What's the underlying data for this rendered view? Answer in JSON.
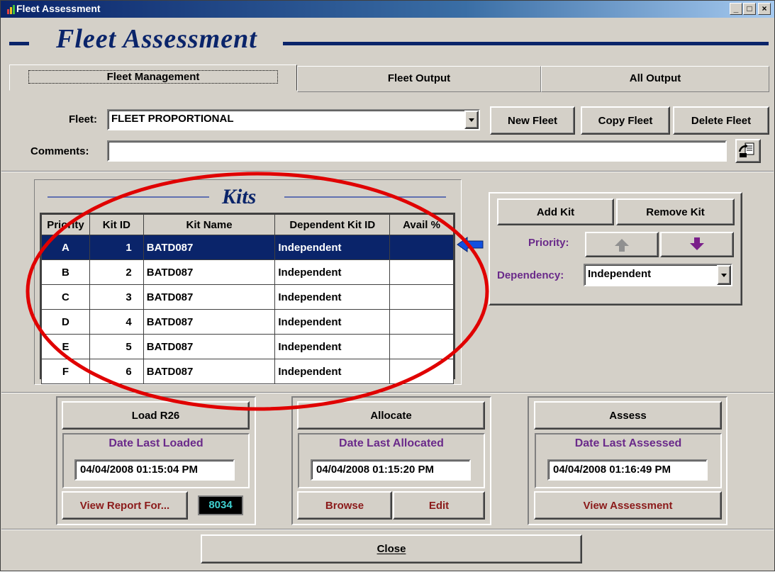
{
  "window": {
    "title": "Fleet Assessment",
    "controls": [
      "_",
      "□",
      "×"
    ]
  },
  "header": {
    "title": "Fleet Assessment"
  },
  "tabs": [
    {
      "label": "Fleet Management",
      "active": true
    },
    {
      "label": "Fleet Output",
      "active": false
    },
    {
      "label": "All Output",
      "active": false
    }
  ],
  "fleet": {
    "label": "Fleet:",
    "value": "FLEET PROPORTIONAL",
    "new_label": "New Fleet",
    "copy_label": "Copy Fleet",
    "delete_label": "Delete Fleet"
  },
  "comments": {
    "label": "Comments:",
    "value": ""
  },
  "kits": {
    "title": "Kits",
    "columns": [
      "Priority",
      "Kit ID",
      "Kit Name",
      "Dependent Kit ID",
      "Avail %"
    ],
    "rows": [
      {
        "priority": "A",
        "kit_id": "1",
        "kit_name": "BATD087",
        "dependent": "Independent",
        "avail": ""
      },
      {
        "priority": "B",
        "kit_id": "2",
        "kit_name": "BATD087",
        "dependent": "Independent",
        "avail": ""
      },
      {
        "priority": "C",
        "kit_id": "3",
        "kit_name": "BATD087",
        "dependent": "Independent",
        "avail": ""
      },
      {
        "priority": "D",
        "kit_id": "4",
        "kit_name": "BATD087",
        "dependent": "Independent",
        "avail": ""
      },
      {
        "priority": "E",
        "kit_id": "5",
        "kit_name": "BATD087",
        "dependent": "Independent",
        "avail": ""
      },
      {
        "priority": "F",
        "kit_id": "6",
        "kit_name": "BATD087",
        "dependent": "Independent",
        "avail": ""
      }
    ],
    "selected_row": 0
  },
  "kit_panel": {
    "add_label": "Add Kit",
    "remove_label": "Remove Kit",
    "priority_label": "Priority:",
    "dependency_label": "Dependency:",
    "dependency_value": "Independent"
  },
  "load": {
    "button_label": "Load R26",
    "date_caption": "Date Last Loaded",
    "date_value": "04/04/2008 01:15:04 PM",
    "report_label": "View Report For...",
    "report_number": "8034"
  },
  "allocate": {
    "button_label": "Allocate",
    "date_caption": "Date Last Allocated",
    "date_value": "04/04/2008 01:15:20 PM",
    "browse_label": "Browse",
    "edit_label": "Edit"
  },
  "assess": {
    "button_label": "Assess",
    "date_caption": "Date Last Assessed",
    "date_value": "04/04/2008 01:16:49 PM",
    "view_label": "View Assessment"
  },
  "close_label": "Close",
  "colors": {
    "navy": "#0a246a",
    "purple": "#6a2a8a",
    "maroon": "#8b1a1a",
    "annotation": "#e00000"
  }
}
